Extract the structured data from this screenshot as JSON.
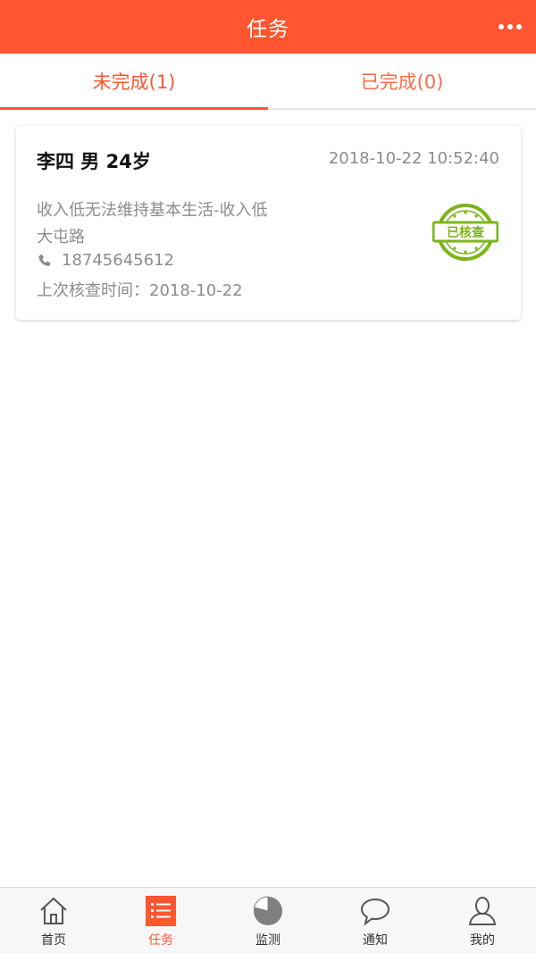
{
  "header": {
    "title": "任务"
  },
  "tabs": [
    {
      "label": "未完成(1)",
      "active": true
    },
    {
      "label": "已完成(0)",
      "active": false
    }
  ],
  "task": {
    "name": "李四 男 24岁",
    "time": "2018-10-22 10:52:40",
    "reason": "收入低无法维持基本生活-收入低",
    "address": "大屯路",
    "phone": "18745645612",
    "last_check": "上次核查时间：2018-10-22",
    "stamp_text": "已核查"
  },
  "tabbar": [
    {
      "label": "首页",
      "icon": "home-icon"
    },
    {
      "label": "任务",
      "icon": "task-list-icon",
      "active": true
    },
    {
      "label": "监测",
      "icon": "pie-chart-icon"
    },
    {
      "label": "通知",
      "icon": "chat-bubble-icon"
    },
    {
      "label": "我的",
      "icon": "user-icon"
    }
  ],
  "colors": {
    "primary": "#ff5530",
    "stamp": "#7cb518",
    "text_muted": "#8c8c8c"
  }
}
